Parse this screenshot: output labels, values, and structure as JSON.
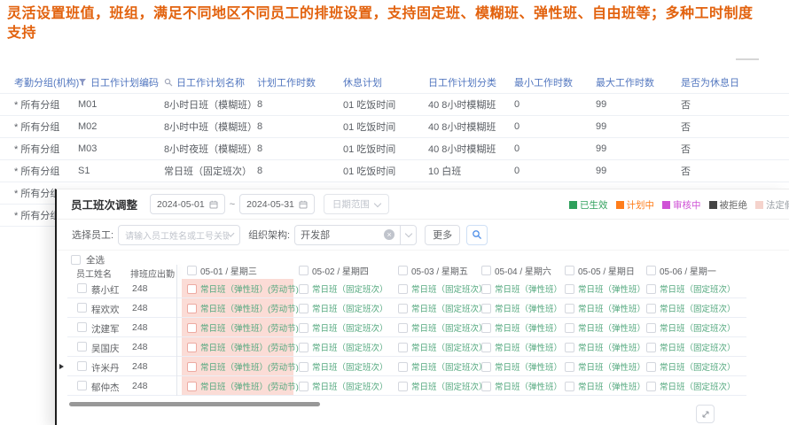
{
  "banner": {
    "text": "灵活设置班值，班组，满足不同地区不同员工的排班设置，支持固定班、模糊班、弹性班、自由班等；多种工时制度支持",
    "color": "#e2620e"
  },
  "plan_table": {
    "headers": [
      "考勤分组(机构)",
      "日工作计划编码",
      "日工作计划名称",
      "计划工作时数",
      "休息计划",
      "日工作计划分类",
      "最小工作时数",
      "最大工作时数",
      "是否为休息日"
    ],
    "header_color": "#5478c0",
    "rows": [
      {
        "group": "* 所有分组",
        "code": "M01",
        "name": "8小时日班（模糊班）",
        "hours": "8",
        "rest_plan": "01 吃饭时间",
        "category": "40 8小时模糊班",
        "min_hours": "0",
        "max_hours": "99",
        "rest_day": "否"
      },
      {
        "group": "* 所有分组",
        "code": "M02",
        "name": "8小时中班（模糊班）",
        "hours": "8",
        "rest_plan": "01 吃饭时间",
        "category": "40 8小时模糊班",
        "min_hours": "0",
        "max_hours": "99",
        "rest_day": "否"
      },
      {
        "group": "* 所有分组",
        "code": "M03",
        "name": "8小时夜班（模糊班）",
        "hours": "8",
        "rest_plan": "01 吃饭时间",
        "category": "40 8小时模糊班",
        "min_hours": "0",
        "max_hours": "99",
        "rest_day": "否"
      },
      {
        "group": "* 所有分组",
        "code": "S1",
        "name": "常日班（固定班次）",
        "hours": "8",
        "rest_plan": "01 吃饭时间",
        "category": "10 白班",
        "min_hours": "0",
        "max_hours": "99",
        "rest_day": "否"
      },
      {
        "group": "* 所有分组",
        "code": "",
        "name": "",
        "hours": "",
        "rest_plan": "",
        "category": "",
        "min_hours": "",
        "max_hours": "",
        "rest_day": ""
      },
      {
        "group": "* 所有分组",
        "code": "",
        "name": "",
        "hours": "",
        "rest_plan": "",
        "category": "",
        "min_hours": "",
        "max_hours": "",
        "rest_day": ""
      }
    ]
  },
  "dialog": {
    "title": "员工班次调整",
    "date_from": "2024-05-01",
    "date_separator": "~",
    "date_to": "2024-05-31",
    "range_label": "日期范围",
    "legend": [
      {
        "label": "已生效",
        "color": "#2fa05c",
        "text_color": "#2fa05c"
      },
      {
        "label": "计划中",
        "color": "#ff7d1a",
        "text_color": "#ff7d1a"
      },
      {
        "label": "审核中",
        "color": "#cf52d6",
        "text_color": "#cf52d6"
      },
      {
        "label": "被拒绝",
        "color": "#454545",
        "text_color": "#666666"
      },
      {
        "label": "法定假日",
        "color": "#f5d3cc",
        "text_color": "#9aa0a6"
      }
    ],
    "filters": {
      "employee_label": "选择员工:",
      "employee_placeholder": "请输入员工姓名或工号关键字",
      "org_label": "组织架构:",
      "org_value": "开发部",
      "more_label": "更多"
    },
    "select_all_label": "全选",
    "grid": {
      "name_header": "员工姓名",
      "count_header": "排班应出勤",
      "shift_text_color": "#53a87e",
      "holiday_bg": "#fbdcd6",
      "day_columns": [
        {
          "label": "05-01 / 星期三"
        },
        {
          "label": "05-02 / 星期四"
        },
        {
          "label": "05-03 / 星期五"
        },
        {
          "label": "05-04 / 星期六"
        },
        {
          "label": "05-05 / 星期日"
        },
        {
          "label": "05-06 / 星期一"
        }
      ],
      "employees": [
        {
          "name": "蔡小红",
          "count": "248"
        },
        {
          "name": "程欢欢",
          "count": "248"
        },
        {
          "name": "沈建军",
          "count": "248"
        },
        {
          "name": "吴国庆",
          "count": "248"
        },
        {
          "name": "许米丹",
          "count": "248",
          "arrow": true
        },
        {
          "name": "郁仲杰",
          "count": "248"
        }
      ],
      "cells": [
        {
          "text": "常日班（弹性班）(劳动节)",
          "holiday": true
        },
        {
          "text": "常日班（固定班次）"
        },
        {
          "text": "常日班（固定班次）"
        },
        {
          "text": "常日班（弹性班）"
        },
        {
          "text": "常日班（弹性班）"
        },
        {
          "text": "常日班（固定班次）"
        }
      ]
    }
  }
}
